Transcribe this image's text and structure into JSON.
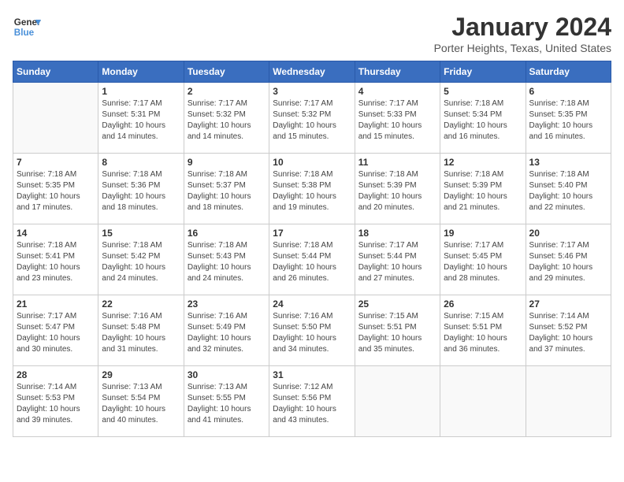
{
  "header": {
    "logo_line1": "General",
    "logo_line2": "Blue",
    "month_year": "January 2024",
    "location": "Porter Heights, Texas, United States"
  },
  "weekdays": [
    "Sunday",
    "Monday",
    "Tuesday",
    "Wednesday",
    "Thursday",
    "Friday",
    "Saturday"
  ],
  "weeks": [
    [
      {
        "day": "",
        "info": ""
      },
      {
        "day": "1",
        "info": "Sunrise: 7:17 AM\nSunset: 5:31 PM\nDaylight: 10 hours\nand 14 minutes."
      },
      {
        "day": "2",
        "info": "Sunrise: 7:17 AM\nSunset: 5:32 PM\nDaylight: 10 hours\nand 14 minutes."
      },
      {
        "day": "3",
        "info": "Sunrise: 7:17 AM\nSunset: 5:32 PM\nDaylight: 10 hours\nand 15 minutes."
      },
      {
        "day": "4",
        "info": "Sunrise: 7:17 AM\nSunset: 5:33 PM\nDaylight: 10 hours\nand 15 minutes."
      },
      {
        "day": "5",
        "info": "Sunrise: 7:18 AM\nSunset: 5:34 PM\nDaylight: 10 hours\nand 16 minutes."
      },
      {
        "day": "6",
        "info": "Sunrise: 7:18 AM\nSunset: 5:35 PM\nDaylight: 10 hours\nand 16 minutes."
      }
    ],
    [
      {
        "day": "7",
        "info": "Sunrise: 7:18 AM\nSunset: 5:35 PM\nDaylight: 10 hours\nand 17 minutes."
      },
      {
        "day": "8",
        "info": "Sunrise: 7:18 AM\nSunset: 5:36 PM\nDaylight: 10 hours\nand 18 minutes."
      },
      {
        "day": "9",
        "info": "Sunrise: 7:18 AM\nSunset: 5:37 PM\nDaylight: 10 hours\nand 18 minutes."
      },
      {
        "day": "10",
        "info": "Sunrise: 7:18 AM\nSunset: 5:38 PM\nDaylight: 10 hours\nand 19 minutes."
      },
      {
        "day": "11",
        "info": "Sunrise: 7:18 AM\nSunset: 5:39 PM\nDaylight: 10 hours\nand 20 minutes."
      },
      {
        "day": "12",
        "info": "Sunrise: 7:18 AM\nSunset: 5:39 PM\nDaylight: 10 hours\nand 21 minutes."
      },
      {
        "day": "13",
        "info": "Sunrise: 7:18 AM\nSunset: 5:40 PM\nDaylight: 10 hours\nand 22 minutes."
      }
    ],
    [
      {
        "day": "14",
        "info": "Sunrise: 7:18 AM\nSunset: 5:41 PM\nDaylight: 10 hours\nand 23 minutes."
      },
      {
        "day": "15",
        "info": "Sunrise: 7:18 AM\nSunset: 5:42 PM\nDaylight: 10 hours\nand 24 minutes."
      },
      {
        "day": "16",
        "info": "Sunrise: 7:18 AM\nSunset: 5:43 PM\nDaylight: 10 hours\nand 24 minutes."
      },
      {
        "day": "17",
        "info": "Sunrise: 7:18 AM\nSunset: 5:44 PM\nDaylight: 10 hours\nand 26 minutes."
      },
      {
        "day": "18",
        "info": "Sunrise: 7:17 AM\nSunset: 5:44 PM\nDaylight: 10 hours\nand 27 minutes."
      },
      {
        "day": "19",
        "info": "Sunrise: 7:17 AM\nSunset: 5:45 PM\nDaylight: 10 hours\nand 28 minutes."
      },
      {
        "day": "20",
        "info": "Sunrise: 7:17 AM\nSunset: 5:46 PM\nDaylight: 10 hours\nand 29 minutes."
      }
    ],
    [
      {
        "day": "21",
        "info": "Sunrise: 7:17 AM\nSunset: 5:47 PM\nDaylight: 10 hours\nand 30 minutes."
      },
      {
        "day": "22",
        "info": "Sunrise: 7:16 AM\nSunset: 5:48 PM\nDaylight: 10 hours\nand 31 minutes."
      },
      {
        "day": "23",
        "info": "Sunrise: 7:16 AM\nSunset: 5:49 PM\nDaylight: 10 hours\nand 32 minutes."
      },
      {
        "day": "24",
        "info": "Sunrise: 7:16 AM\nSunset: 5:50 PM\nDaylight: 10 hours\nand 34 minutes."
      },
      {
        "day": "25",
        "info": "Sunrise: 7:15 AM\nSunset: 5:51 PM\nDaylight: 10 hours\nand 35 minutes."
      },
      {
        "day": "26",
        "info": "Sunrise: 7:15 AM\nSunset: 5:51 PM\nDaylight: 10 hours\nand 36 minutes."
      },
      {
        "day": "27",
        "info": "Sunrise: 7:14 AM\nSunset: 5:52 PM\nDaylight: 10 hours\nand 37 minutes."
      }
    ],
    [
      {
        "day": "28",
        "info": "Sunrise: 7:14 AM\nSunset: 5:53 PM\nDaylight: 10 hours\nand 39 minutes."
      },
      {
        "day": "29",
        "info": "Sunrise: 7:13 AM\nSunset: 5:54 PM\nDaylight: 10 hours\nand 40 minutes."
      },
      {
        "day": "30",
        "info": "Sunrise: 7:13 AM\nSunset: 5:55 PM\nDaylight: 10 hours\nand 41 minutes."
      },
      {
        "day": "31",
        "info": "Sunrise: 7:12 AM\nSunset: 5:56 PM\nDaylight: 10 hours\nand 43 minutes."
      },
      {
        "day": "",
        "info": ""
      },
      {
        "day": "",
        "info": ""
      },
      {
        "day": "",
        "info": ""
      }
    ]
  ]
}
